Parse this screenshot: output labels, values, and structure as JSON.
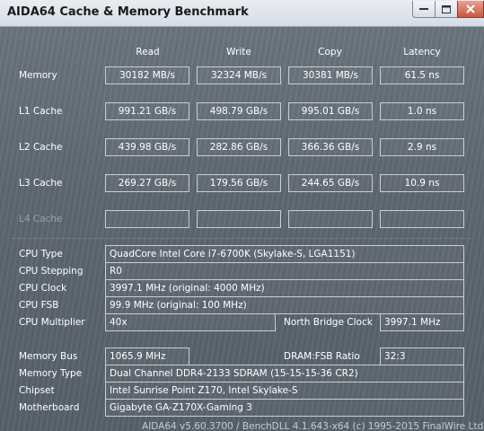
{
  "window": {
    "title": "AIDA64 Cache & Memory Benchmark",
    "buttons": {
      "minimize": "minimize-icon",
      "maximize": "maximize-icon",
      "close": "close-icon"
    }
  },
  "columns": {
    "read": "Read",
    "write": "Write",
    "copy": "Copy",
    "latency": "Latency"
  },
  "rows": {
    "memory": {
      "label": "Memory",
      "read": "30182 MB/s",
      "write": "32324 MB/s",
      "copy": "30381 MB/s",
      "latency": "61.5 ns"
    },
    "l1": {
      "label": "L1 Cache",
      "read": "991.21 GB/s",
      "write": "498.79 GB/s",
      "copy": "995.01 GB/s",
      "latency": "1.0 ns"
    },
    "l2": {
      "label": "L2 Cache",
      "read": "439.98 GB/s",
      "write": "282.86 GB/s",
      "copy": "366.36 GB/s",
      "latency": "2.9 ns"
    },
    "l3": {
      "label": "L3 Cache",
      "read": "269.27 GB/s",
      "write": "179.56 GB/s",
      "copy": "244.65 GB/s",
      "latency": "10.9 ns"
    },
    "l4": {
      "label": "L4 Cache",
      "read": "",
      "write": "",
      "copy": "",
      "latency": ""
    }
  },
  "cpu": {
    "type_label": "CPU Type",
    "type_value": "QuadCore Intel Core i7-6700K  (Skylake-S, LGA1151)",
    "stepping_label": "CPU Stepping",
    "stepping_value": "R0",
    "clock_label": "CPU Clock",
    "clock_value": "3997.1 MHz  (original: 4000 MHz)",
    "fsb_label": "CPU FSB",
    "fsb_value": "99.9 MHz  (original: 100 MHz)",
    "multiplier_label": "CPU Multiplier",
    "multiplier_value": "40x",
    "nb_clock_label": "North Bridge Clock",
    "nb_clock_value": "3997.1 MHz"
  },
  "memory_info": {
    "bus_label": "Memory Bus",
    "bus_value": "1065.9 MHz",
    "ratio_label": "DRAM:FSB Ratio",
    "ratio_value": "32:3",
    "type_label": "Memory Type",
    "type_value": "Dual Channel DDR4-2133 SDRAM  (15-15-15-36 CR2)",
    "chipset_label": "Chipset",
    "chipset_value": "Intel Sunrise Point Z170, Intel Skylake-S",
    "motherboard_label": "Motherboard",
    "motherboard_value": "Gigabyte GA-Z170X-Gaming 3"
  },
  "footer": "AIDA64 v5.60.3700 / BenchDLL 4.1.643-x64  (c) 1995-2015 FinalWire Ltd."
}
